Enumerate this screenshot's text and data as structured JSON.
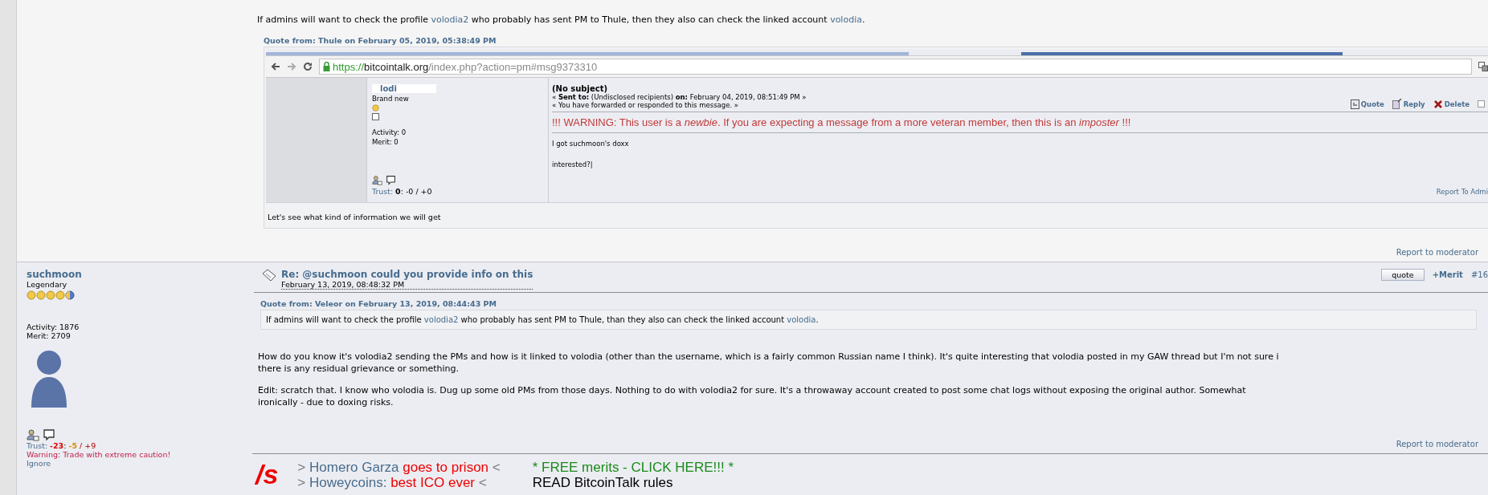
{
  "upper_post": {
    "text": [
      {
        "text": "If admins will want to check the profile "
      },
      {
        "text": "volodia2",
        "kind": "link"
      },
      {
        "text": " who probably has sent PM to Thule, then they also can check the linked account "
      },
      {
        "text": "volodia",
        "kind": "link"
      },
      {
        "text": "."
      }
    ],
    "quote": {
      "header": "Quote from: Thule on February 05, 2019, 05:38:49 PM",
      "screenshot": {
        "url": {
          "scheme": "https://",
          "host": "bitcointalk.org",
          "path": "/index.php?action=pm#msg9373310"
        },
        "sender": {
          "name": "lodi",
          "rank": "Brand new",
          "activity": "Activity: 0",
          "merit": "Merit: 0",
          "trust": [
            {
              "text": "Trust:",
              "kind": "label"
            },
            {
              "text": "0",
              "kind": "score"
            },
            {
              "text": ": -0 / +0"
            }
          ]
        },
        "message": {
          "subject": "(No subject)",
          "sent_to": "« **Sent to:** (Undisclosed recipients) **on:** February 04, 2019, 08:51:49 PM »",
          "note": "« You have forwarded or responded to this message. »",
          "actions": [
            {
              "label": "Quote",
              "kind": "quote"
            },
            {
              "label": "Reply",
              "kind": "reply"
            },
            {
              "label": "Delete",
              "kind": "delete"
            }
          ],
          "checked": false,
          "warning": "!!! WARNING: This user is a *newbie*. If you are expecting a message from a more veteran member, then this is an *imposter* !!!",
          "lines": [
            "I got suchmoon's doxx",
            "interested?|"
          ],
          "report": "Report To Admi"
        }
      },
      "caption": "Let's see what kind of information we will get"
    },
    "report": "Report to moderator"
  },
  "post": {
    "author": {
      "name": "suchmoon",
      "rank": "Legendary",
      "stars": 4.5,
      "activity": "Activity: 1876",
      "merit": "Merit: 2709",
      "trust": [
        {
          "text": "Trust:",
          "kind": "label"
        },
        {
          "text": "-23",
          "kind": "bad"
        },
        {
          "text": ": "
        },
        {
          "text": "-5",
          "kind": "warn"
        },
        {
          "text": " / +9",
          "kind": "tail"
        }
      ],
      "warning": "Warning: Trade with extreme caution!",
      "ignore": "Ignore"
    },
    "title": "Re: @suchmoon could you provide info on this",
    "date": "February 13, 2019, 08:48:32 PM",
    "quote_button": "quote",
    "merit": "+Merit",
    "number": "#16",
    "quote": {
      "header": "Quote from: Veleor on February 13, 2019, 08:44:43 PM",
      "text": [
        {
          "text": "If admins will want to check the profile "
        },
        {
          "text": "volodia2",
          "kind": "link"
        },
        {
          "text": " who probably has sent PM to Thule, than they also can check the linked account "
        },
        {
          "text": "volodia",
          "kind": "link"
        },
        {
          "text": "."
        }
      ]
    },
    "body": [
      [
        "How do you know it's volodia2 sending the PMs and how is it linked to volodia (other than the username, which is a fairly common Russian name I think). It's quite interesting that volodia posted in my GAW thread but I'm not sure i",
        "there is any residual grievance or something."
      ],
      [
        "Edit: scratch that. I know who volodia is. Dug up some old PMs from those days. Nothing to do with volodia2 for sure. It's a throwaway account created to post some chat logs without exposing the original author. Somewhat",
        "ironically - due to doxing risks."
      ]
    ],
    "report": "Report to moderator",
    "signature": {
      "mark": "/s",
      "lines": [
        {
          "prefix": ">",
          "name": "Homero Garza",
          "highlight": "goes to prison",
          "suffix": "<",
          "link": "* FREE merits - CLICK HERE!!! *",
          "kind": "promo"
        },
        {
          "prefix": ">",
          "name": "Howeycoins:",
          "highlight": "best ICO ever",
          "suffix": "<",
          "link": "READ BitcoinTalk rules",
          "kind": "rules"
        }
      ]
    }
  }
}
